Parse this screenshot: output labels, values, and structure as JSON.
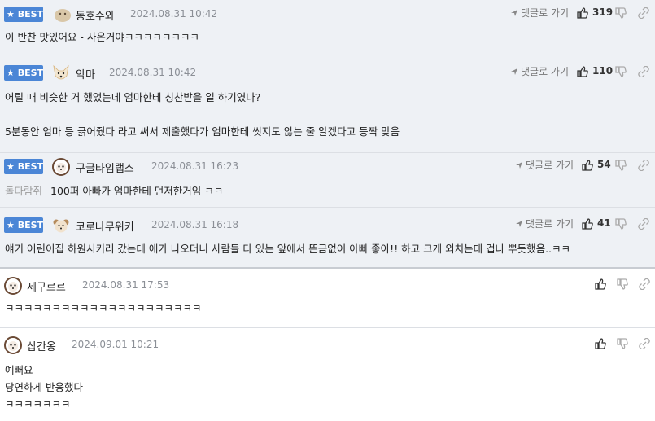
{
  "reply_label": "댓글로 가기",
  "best_label": "★ BEST",
  "comments": [
    {
      "nick": "동호수와",
      "date": "2024.08.31 10:42",
      "likes": "319",
      "body": "이 반찬 맛있어요 - 사온거야ㅋㅋㅋㅋㅋㅋㅋㅋ",
      "avatar": "round-face"
    },
    {
      "nick": "악마",
      "date": "2024.08.31 10:42",
      "likes": "110",
      "body": "어릴 때 비슷한 거 했었는데 엄마한테 칭찬받을 일 하기였나?\n\n5분동안 엄마 등 긁어줬다 라고 써서 제출했다가 엄마한테 씻지도 않는 줄 알겠다고 등짝 맞음",
      "avatar": "fox"
    },
    {
      "nick": "구글타임랩스",
      "date": "2024.08.31 16:23",
      "likes": "54",
      "prefix": "돌다람쥐",
      "body": "100퍼 아빠가 엄마한테 먼저한거임 ㅋㅋ",
      "avatar": "puppy"
    },
    {
      "nick": "코로나무위키",
      "date": "2024.08.31 16:18",
      "likes": "41",
      "body": "얘기 어린이집 하원시키러 갔는데 애가 나오더니 사람들 다 있는 앞에서 뜬금없이 아빠 좋아!! 하고 크게 외치는데 겁나 뿌듯했음..ㅋㅋ",
      "avatar": "puppy-small"
    },
    {
      "nick": "세구르르",
      "date": "2024.08.31 17:53",
      "body": "ㅋㅋㅋㅋㅋㅋㅋㅋㅋㅋㅋㅋㅋㅋㅋㅋㅋㅋㅋㅋㅋ",
      "avatar": "puppy"
    },
    {
      "nick": "삽간옹",
      "date": "2024.09.01 10:21",
      "body": "예뻐요\n당연하게 반응했다\nㅋㅋㅋㅋㅋㅋㅋ",
      "avatar": "puppy"
    }
  ]
}
